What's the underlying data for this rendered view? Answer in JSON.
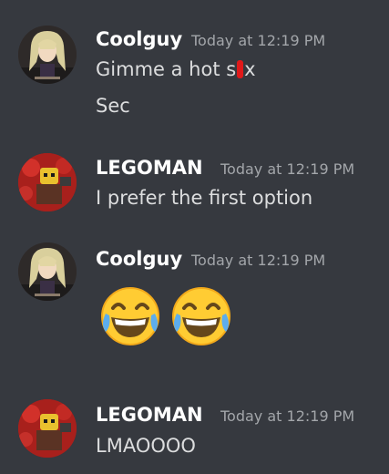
{
  "messages": [
    {
      "author": "Coolguy",
      "timestamp": "Today at 12:19 PM",
      "lines": [
        "Gimme a hot s",
        "x",
        "Sec"
      ]
    },
    {
      "author": "LEGOMAN",
      "timestamp": "Today at 12:19 PM",
      "lines": [
        "I prefer the first option"
      ]
    },
    {
      "author": "Coolguy",
      "timestamp": "Today at 12:19 PM",
      "emojis": [
        "face-with-tears-of-joy",
        "face-with-tears-of-joy"
      ]
    },
    {
      "author": "LEGOMAN",
      "timestamp": "Today at 12:19 PM",
      "lines": [
        "LMAOOOO"
      ]
    }
  ],
  "colors": {
    "background": "#36393f",
    "username": "#ffffff",
    "timestamp": "#a3a6aa",
    "message_text": "#dcddde",
    "redaction_mark": "#e0191a"
  }
}
